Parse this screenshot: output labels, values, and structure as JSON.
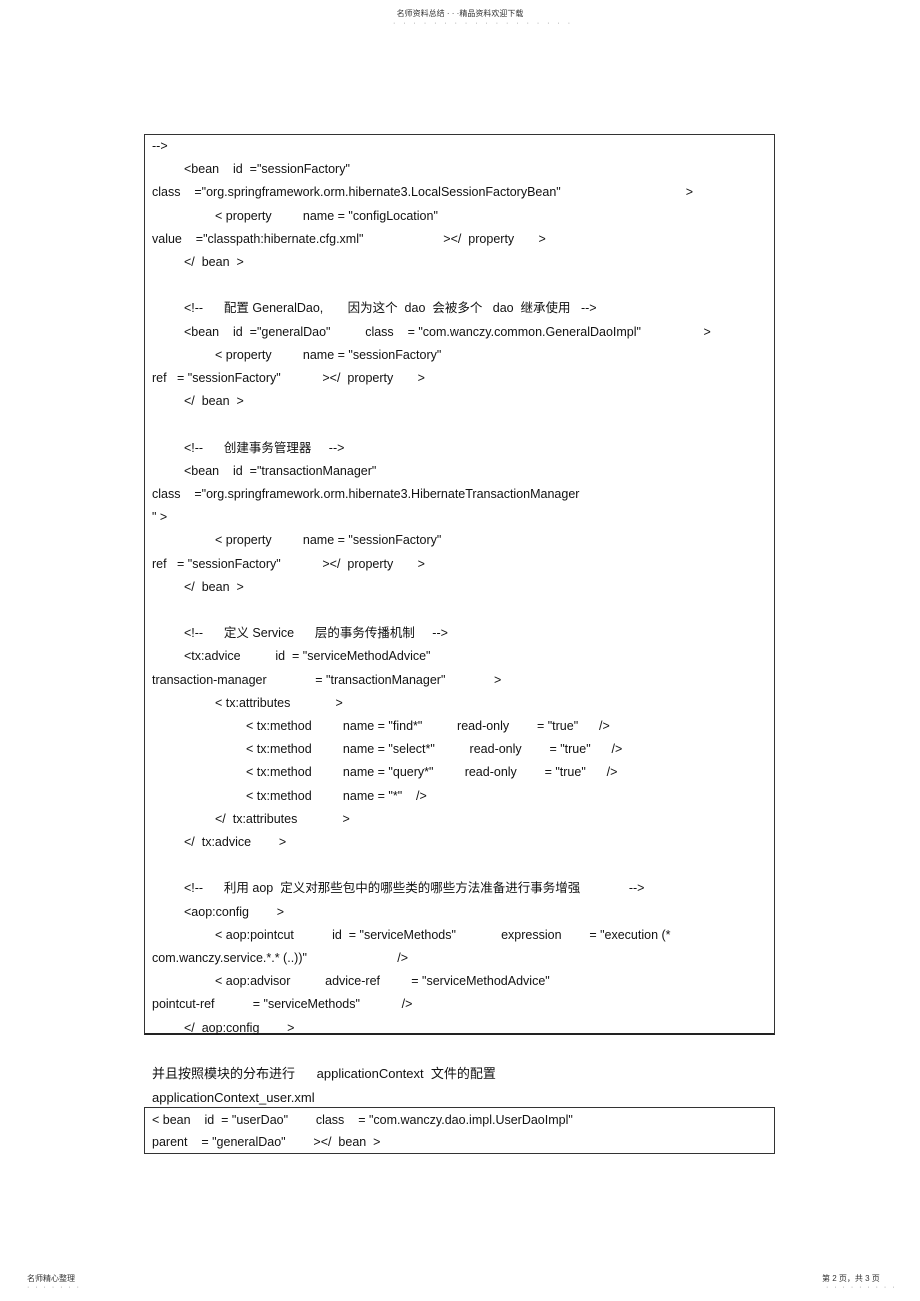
{
  "header": {
    "text": "名师资料总结 · · ·精品资料欢迎下载",
    "dots": "· · · · · · · · · · · · · · · · · ·"
  },
  "code_block_1": {
    "lines": [
      {
        "indent": 0,
        "text": "-->"
      },
      {
        "indent": 1,
        "text": "<bean    id  =\"sessionFactory\""
      },
      {
        "indent": 0,
        "text": "class    =\"org.springframework.orm.hibernate3.LocalSessionFactoryBean\"                                    >"
      },
      {
        "indent": 2,
        "text": "< property         name = \"configLocation\""
      },
      {
        "indent": 0,
        "text": "value    =\"classpath:hibernate.cfg.xml\"                       ></  property       >"
      },
      {
        "indent": 1,
        "text": "</  bean  >"
      },
      {
        "indent": 0,
        "text": ""
      },
      {
        "indent": 1,
        "text": "<!--      配置 GeneralDao,       因为这个  dao  会被多个   dao  继承使用   -->"
      },
      {
        "indent": 1,
        "text": "<bean    id  =\"generalDao\"          class    = \"com.wanczy.common.GeneralDaoImpl\"                  >"
      },
      {
        "indent": 2,
        "text": "< property         name = \"sessionFactory\""
      },
      {
        "indent": 0,
        "text": "ref   = \"sessionFactory\"            ></  property       >"
      },
      {
        "indent": 1,
        "text": "</  bean  >"
      },
      {
        "indent": 0,
        "text": ""
      },
      {
        "indent": 1,
        "text": "<!--      创建事务管理器     -->"
      },
      {
        "indent": 1,
        "text": "<bean    id  =\"transactionManager\""
      },
      {
        "indent": 0,
        "text": "class    =\"org.springframework.orm.hibernate3.HibernateTransactionManager"
      },
      {
        "indent": 0,
        "text": "\" >"
      },
      {
        "indent": 2,
        "text": "< property         name = \"sessionFactory\""
      },
      {
        "indent": 0,
        "text": "ref   = \"sessionFactory\"            ></  property       >"
      },
      {
        "indent": 1,
        "text": "</  bean  >"
      },
      {
        "indent": 0,
        "text": ""
      },
      {
        "indent": 1,
        "text": "<!--      定义 Service      层的事务传播机制     -->"
      },
      {
        "indent": 1,
        "text": "<tx:advice          id  = \"serviceMethodAdvice\""
      },
      {
        "indent": 0,
        "text": "transaction-manager              = \"transactionManager\"              >"
      },
      {
        "indent": 2,
        "text": "< tx:attributes             >"
      },
      {
        "indent": 3,
        "text": "< tx:method         name = \"find*\"          read-only        = \"true\"      />"
      },
      {
        "indent": 3,
        "text": "< tx:method         name = \"select*\"          read-only        = \"true\"      />"
      },
      {
        "indent": 3,
        "text": "< tx:method         name = \"query*\"         read-only        = \"true\"      />"
      },
      {
        "indent": 3,
        "text": "< tx:method         name = \"*\"    />"
      },
      {
        "indent": 2,
        "text": "</  tx:attributes             >"
      },
      {
        "indent": 1,
        "text": "</  tx:advice        >"
      },
      {
        "indent": 0,
        "text": ""
      },
      {
        "indent": 1,
        "text": "<!--      利用 aop  定义对那些包中的哪些类的哪些方法准备进行事务增强              -->"
      },
      {
        "indent": 1,
        "text": "<aop:config        >"
      },
      {
        "indent": 2,
        "text": "< aop:pointcut           id  = \"serviceMethods\"             expression        = \"execution (*"
      },
      {
        "indent": 0,
        "text": "com.wanczy.service.*.* (..))\"                          />"
      },
      {
        "indent": 2,
        "text": "< aop:advisor          advice-ref         = \"serviceMethodAdvice\""
      },
      {
        "indent": 0,
        "text": "pointcut-ref           = \"serviceMethods\"            />"
      },
      {
        "indent": 1,
        "text": "</  aop:config        >"
      }
    ]
  },
  "paragraph": "并且按照模块的分布进行      applicationContext  文件的配置",
  "filename": "applicationContext_user.xml",
  "code_block_2": {
    "lines": [
      {
        "indent": 0,
        "text": "< bean    id  = \"userDao\"        class    = \"com.wanczy.dao.impl.UserDaoImpl\""
      },
      {
        "indent": 0,
        "text": "parent    = \"generalDao\"        ></  bean  >"
      }
    ]
  },
  "footer": {
    "left": "名师精心整理",
    "left_dots": "· · · · · · ·",
    "right": "第 2 页，共 3 页",
    "right_dots": "· · · · · · · · ·"
  }
}
